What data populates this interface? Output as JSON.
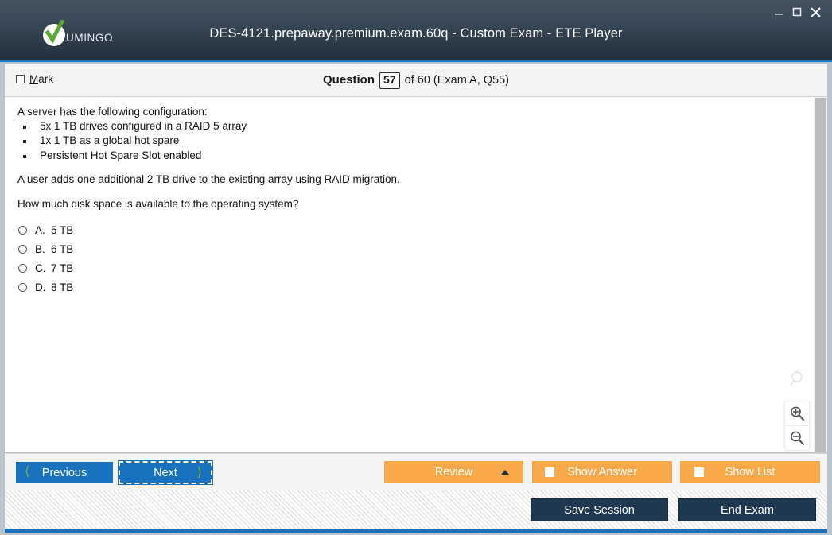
{
  "window": {
    "title": "DES-4121.prepaway.premium.exam.60q - Custom Exam - ETE Player",
    "brand_text": "UMINGO",
    "controls": {
      "minimize": "minimize-icon",
      "maximize": "maximize-icon",
      "close": "close-icon"
    },
    "colors": {
      "titlebar_top": "#44525f",
      "titlebar_bottom": "#22303f",
      "accent_blue": "#1a72bf",
      "orange": "#f9a94a",
      "green_check": "#5aa832",
      "dark_navy": "#1d3850"
    }
  },
  "question_bar": {
    "mark_label_accel": "M",
    "mark_label_rest": "ark",
    "question_word": "Question",
    "question_number": "57",
    "counter_suffix": "of 60 (Exam A, Q55)"
  },
  "question": {
    "intro": "A server has the following configuration:",
    "bullets": [
      "5x 1 TB drives configured in a RAID 5 array",
      "1x 1 TB as a global hot spare",
      "Persistent Hot Spare Slot enabled"
    ],
    "paragraph": "A user adds one additional 2 TB drive to the existing array using RAID migration.",
    "prompt": "How much disk space is available to the operating system?",
    "options": [
      {
        "letter": "A.",
        "text": "5 TB",
        "selected": false
      },
      {
        "letter": "B.",
        "text": "6 TB",
        "selected": false
      },
      {
        "letter": "C.",
        "text": "7 TB",
        "selected": false
      },
      {
        "letter": "D.",
        "text": "8 TB",
        "selected": false
      }
    ]
  },
  "zoom_widget": {
    "ghost_icon": "magnifier-icon",
    "zoom_in_icon": "zoom-in-icon",
    "zoom_out_icon": "zoom-out-icon"
  },
  "nav": {
    "previous_label": "Previous",
    "next_label": "Next",
    "review_label": "Review",
    "show_answer_label": "Show Answer",
    "show_list_label": "Show List"
  },
  "footer": {
    "save_session_label": "Save Session",
    "end_exam_label": "End Exam"
  }
}
